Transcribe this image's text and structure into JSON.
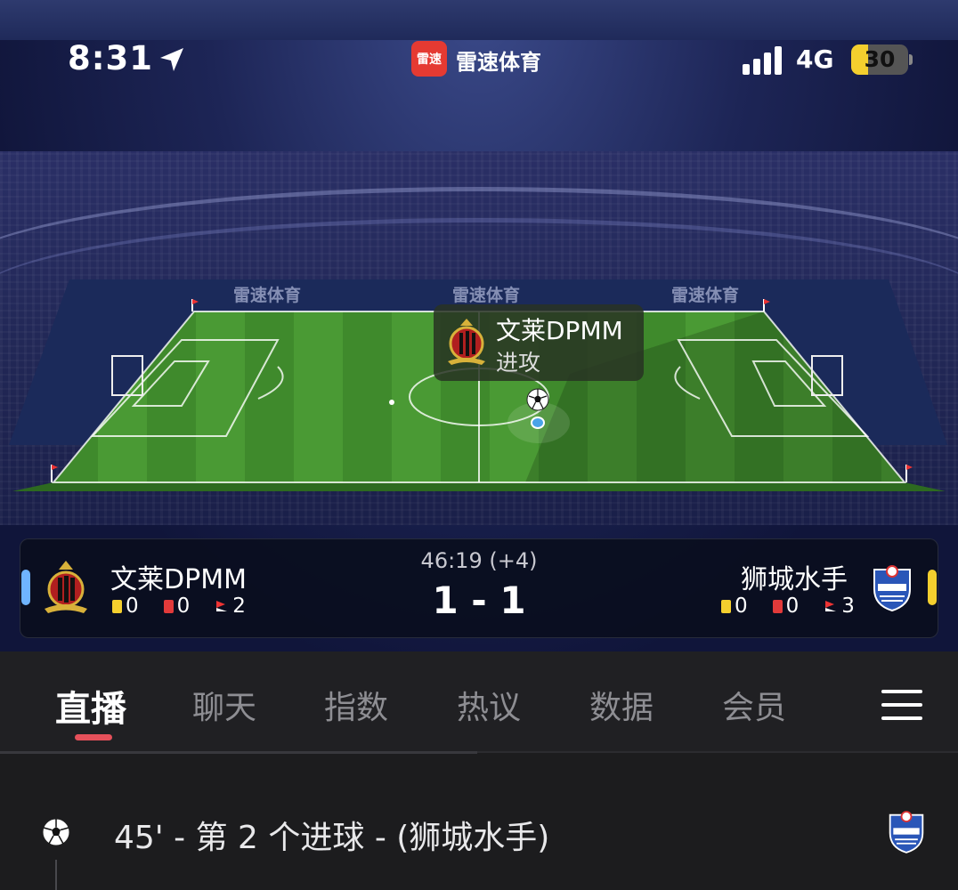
{
  "status_bar": {
    "time": "8:31",
    "network": "4G",
    "battery_level": "30",
    "battery_fraction": 0.3
  },
  "app": {
    "badge_text": "雷速",
    "name": "雷速体育",
    "ad_board_text": "雷速体育"
  },
  "live_tooltip": {
    "team": "文莱DPMM",
    "action": "进攻"
  },
  "match": {
    "clock": "46:19 (+4)",
    "score": "1 - 1",
    "home": {
      "name": "文莱DPMM",
      "yellow_cards": "0",
      "red_cards": "0",
      "corners": "2",
      "color": "#6fb4ff"
    },
    "away": {
      "name": "狮城水手",
      "yellow_cards": "0",
      "red_cards": "0",
      "corners": "3",
      "color": "#f4cf2e"
    }
  },
  "tabs": [
    {
      "label": "直播",
      "active": true
    },
    {
      "label": "聊天",
      "active": false
    },
    {
      "label": "指数",
      "active": false
    },
    {
      "label": "热议",
      "active": false
    },
    {
      "label": "数据",
      "active": false
    },
    {
      "label": "会员",
      "active": false
    }
  ],
  "events": [
    {
      "icon": "soccer-ball-icon",
      "text": "45' - 第 2 个进球 - (狮城水手)"
    }
  ],
  "colors": {
    "tab_accent": "#e5505a",
    "pitch_green": "#3f8f2f"
  }
}
